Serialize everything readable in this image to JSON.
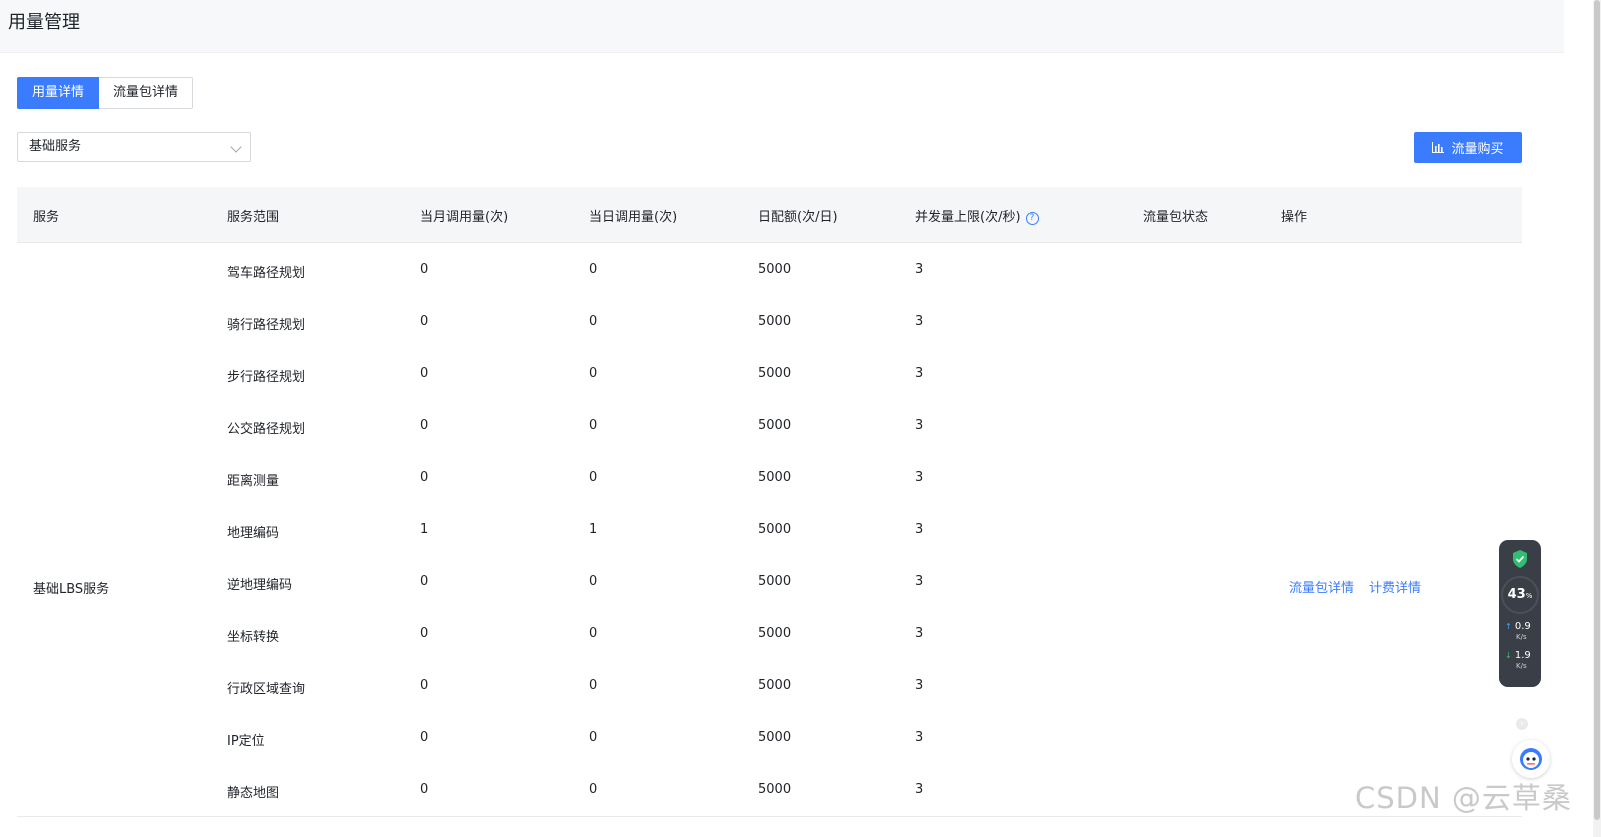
{
  "header": {
    "title": "用量管理"
  },
  "tabs": [
    {
      "label": "用量详情",
      "active": true
    },
    {
      "label": "流量包详情",
      "active": false
    }
  ],
  "filter": {
    "selected": "基础服务"
  },
  "toolbar": {
    "buy_label": "流量购买"
  },
  "table": {
    "columns": [
      "服务",
      "服务范围",
      "当月调用量(次)",
      "当日调用量(次)",
      "日配额(次/日)",
      "并发量上限(次/秒)",
      "流量包状态",
      "操作"
    ],
    "service_group": "基础LBS服务",
    "rows": [
      {
        "scope": "驾车路径规划",
        "monthly": "0",
        "daily": "0",
        "quota": "5000",
        "concurrency": "3"
      },
      {
        "scope": "骑行路径规划",
        "monthly": "0",
        "daily": "0",
        "quota": "5000",
        "concurrency": "3"
      },
      {
        "scope": "步行路径规划",
        "monthly": "0",
        "daily": "0",
        "quota": "5000",
        "concurrency": "3"
      },
      {
        "scope": "公交路径规划",
        "monthly": "0",
        "daily": "0",
        "quota": "5000",
        "concurrency": "3"
      },
      {
        "scope": "距离测量",
        "monthly": "0",
        "daily": "0",
        "quota": "5000",
        "concurrency": "3"
      },
      {
        "scope": "地理编码",
        "monthly": "1",
        "daily": "1",
        "quota": "5000",
        "concurrency": "3"
      },
      {
        "scope": "逆地理编码",
        "monthly": "0",
        "daily": "0",
        "quota": "5000",
        "concurrency": "3"
      },
      {
        "scope": "坐标转换",
        "monthly": "0",
        "daily": "0",
        "quota": "5000",
        "concurrency": "3"
      },
      {
        "scope": "行政区域查询",
        "monthly": "0",
        "daily": "0",
        "quota": "5000",
        "concurrency": "3"
      },
      {
        "scope": "IP定位",
        "monthly": "0",
        "daily": "0",
        "quota": "5000",
        "concurrency": "3"
      },
      {
        "scope": "静态地图",
        "monthly": "0",
        "daily": "0",
        "quota": "5000",
        "concurrency": "3"
      }
    ],
    "operations": [
      "流量包详情",
      "计费详情"
    ]
  },
  "widget": {
    "percent": "43",
    "percent_unit": "%",
    "upload": "0.9",
    "download": "1.9",
    "unit": "K/s"
  },
  "watermark": "CSDN @云草桑",
  "colors": {
    "primary": "#3b7cff",
    "header_bg": "#f5f6f8"
  }
}
